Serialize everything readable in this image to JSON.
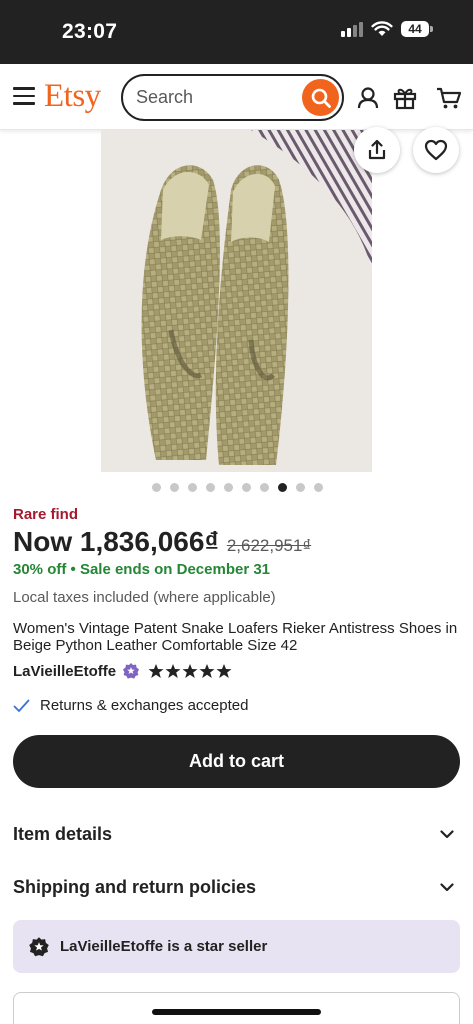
{
  "status": {
    "time": "23:07",
    "battery": "44"
  },
  "header": {
    "logo": "Etsy",
    "search_placeholder": "Search"
  },
  "gallery": {
    "image_count": 10,
    "active_index": 7
  },
  "product": {
    "badge": "Rare find",
    "price_now": "Now 1,836,066₫",
    "price_original": "2,622,951₫",
    "discount": "30% off",
    "sale_end": "Sale ends on December 31",
    "taxes": "Local taxes included (where applicable)",
    "title": "Women's Vintage Patent Snake Loafers Rieker Antistress Shoes in Beige Python Leather Comfortable Size 42",
    "shop_name": "LaVieilleEtoffe",
    "rating_stars": 5,
    "returns": "Returns & exchanges accepted"
  },
  "actions": {
    "add_to_cart": "Add to cart"
  },
  "accordions": {
    "item_details": "Item details",
    "shipping": "Shipping and return policies"
  },
  "star_seller": {
    "text": "LaVieilleEtoffe is a star seller"
  },
  "colors": {
    "brand": "#f1641e",
    "rare": "#a61a2e",
    "sale": "#258635",
    "star_seller_bg": "#e7e3f2"
  }
}
